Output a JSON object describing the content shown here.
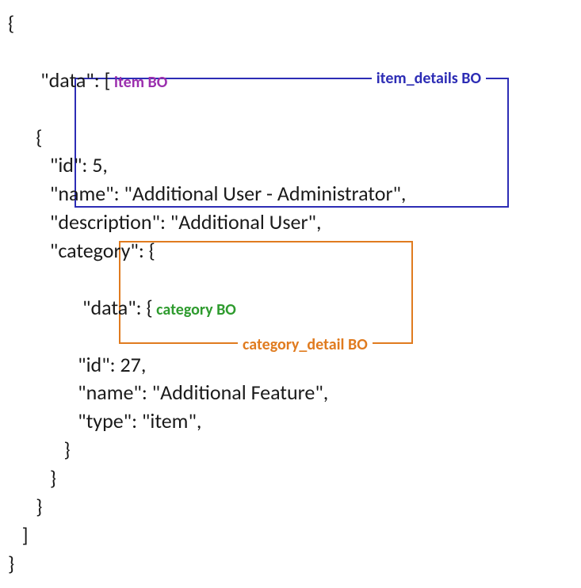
{
  "lines": {
    "l0": "{",
    "l1a": "   \"data\": [",
    "l1b": " item BO",
    "l2": "      {",
    "l3": "         \"id\": 5,",
    "l4": "         \"name\": \"Additional User - Administrator\",",
    "l5": "         \"description\": \"Additional User\",",
    "l6": "         \"category\": {",
    "l7a": "            \"data\": {",
    "l7b": " category BO",
    "l8": "               \"id\": 27,",
    "l9": "               \"name\": \"Additional Feature\",",
    "l10": "               \"type\": \"item\",",
    "l11": "            }",
    "l12": "         }",
    "l13": "      }",
    "l14": "   ]",
    "l15": "}"
  },
  "labels": {
    "item_details": "item_details BO",
    "category_detail": "category_detail BO"
  }
}
